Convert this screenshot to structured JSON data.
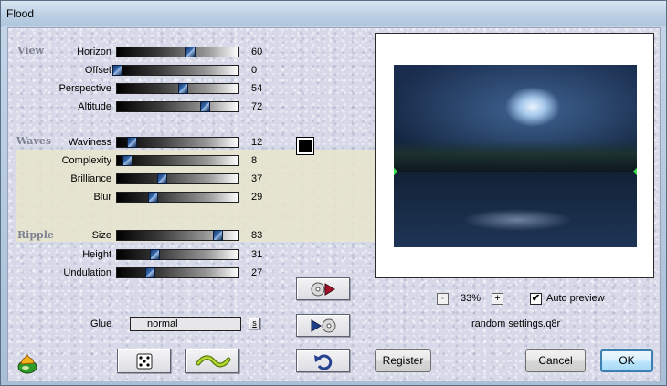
{
  "window": {
    "title": "Flood"
  },
  "sections": {
    "view": "View",
    "waves": "Waves",
    "ripple": "Ripple"
  },
  "sliders": {
    "view": [
      {
        "label": "Horizon",
        "value": 60
      },
      {
        "label": "Offset",
        "value": 0
      },
      {
        "label": "Perspective",
        "value": 54
      },
      {
        "label": "Altitude",
        "value": 72
      }
    ],
    "waves": [
      {
        "label": "Waviness",
        "value": 12
      },
      {
        "label": "Complexity",
        "value": 8
      },
      {
        "label": "Brilliance",
        "value": 37
      },
      {
        "label": "Blur",
        "value": 29
      }
    ],
    "ripple": [
      {
        "label": "Size",
        "value": 83
      },
      {
        "label": "Height",
        "value": 31
      },
      {
        "label": "Undulation",
        "value": 27
      }
    ]
  },
  "glue": {
    "label": "Glue",
    "value": "normal",
    "menu_button": "s"
  },
  "preview": {
    "zoom": "33%",
    "zoom_out": "-",
    "zoom_in": "+",
    "auto_preview_label": "Auto preview",
    "auto_preview_checked": true,
    "settings_file": "random settings.q8r"
  },
  "buttons": {
    "register": "Register",
    "cancel": "Cancel",
    "ok": "OK"
  },
  "icons": {
    "color_swatch": "#000000"
  }
}
